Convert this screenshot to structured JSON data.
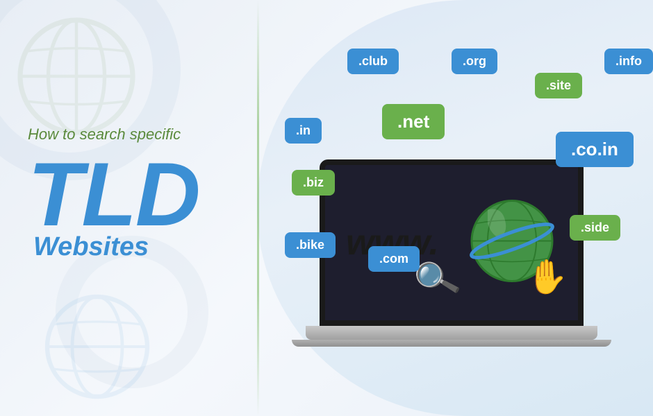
{
  "page": {
    "background_color": "#f0f4f8",
    "accent_green": "#6ab04c",
    "accent_blue": "#3b8fd4"
  },
  "left": {
    "subtitle": "How to search specific",
    "tld": "TLD",
    "websites": "Websites"
  },
  "badges": [
    {
      "id": "club",
      "label": ".club",
      "color": "blue",
      "size": "normal",
      "pos_class": "badge-club"
    },
    {
      "id": "org",
      "label": ".org",
      "color": "blue",
      "size": "normal",
      "pos_class": "badge-org"
    },
    {
      "id": "site",
      "label": ".site",
      "color": "green",
      "size": "normal",
      "pos_class": "badge-site"
    },
    {
      "id": "info",
      "label": ".info",
      "color": "blue",
      "size": "normal",
      "pos_class": "badge-info"
    },
    {
      "id": "in",
      "label": ".in",
      "color": "blue",
      "size": "normal",
      "pos_class": "badge-in"
    },
    {
      "id": "net",
      "label": ".net",
      "color": "green",
      "size": "large",
      "pos_class": "badge-net"
    },
    {
      "id": "coin",
      "label": ".co.in",
      "color": "blue",
      "size": "large",
      "pos_class": "badge-coin"
    },
    {
      "id": "biz",
      "label": ".biz",
      "color": "green",
      "size": "normal",
      "pos_class": "badge-biz"
    },
    {
      "id": "side",
      "label": ".side",
      "color": "green",
      "size": "normal",
      "pos_class": "badge-side"
    },
    {
      "id": "bike",
      "label": ".bike",
      "color": "blue",
      "size": "normal",
      "pos_class": "badge-bike"
    },
    {
      "id": "com",
      "label": ".com",
      "color": "blue",
      "size": "normal",
      "pos_class": "badge-com"
    }
  ],
  "screen": {
    "www_text": "www.",
    "globe_alt": "globe icon"
  }
}
